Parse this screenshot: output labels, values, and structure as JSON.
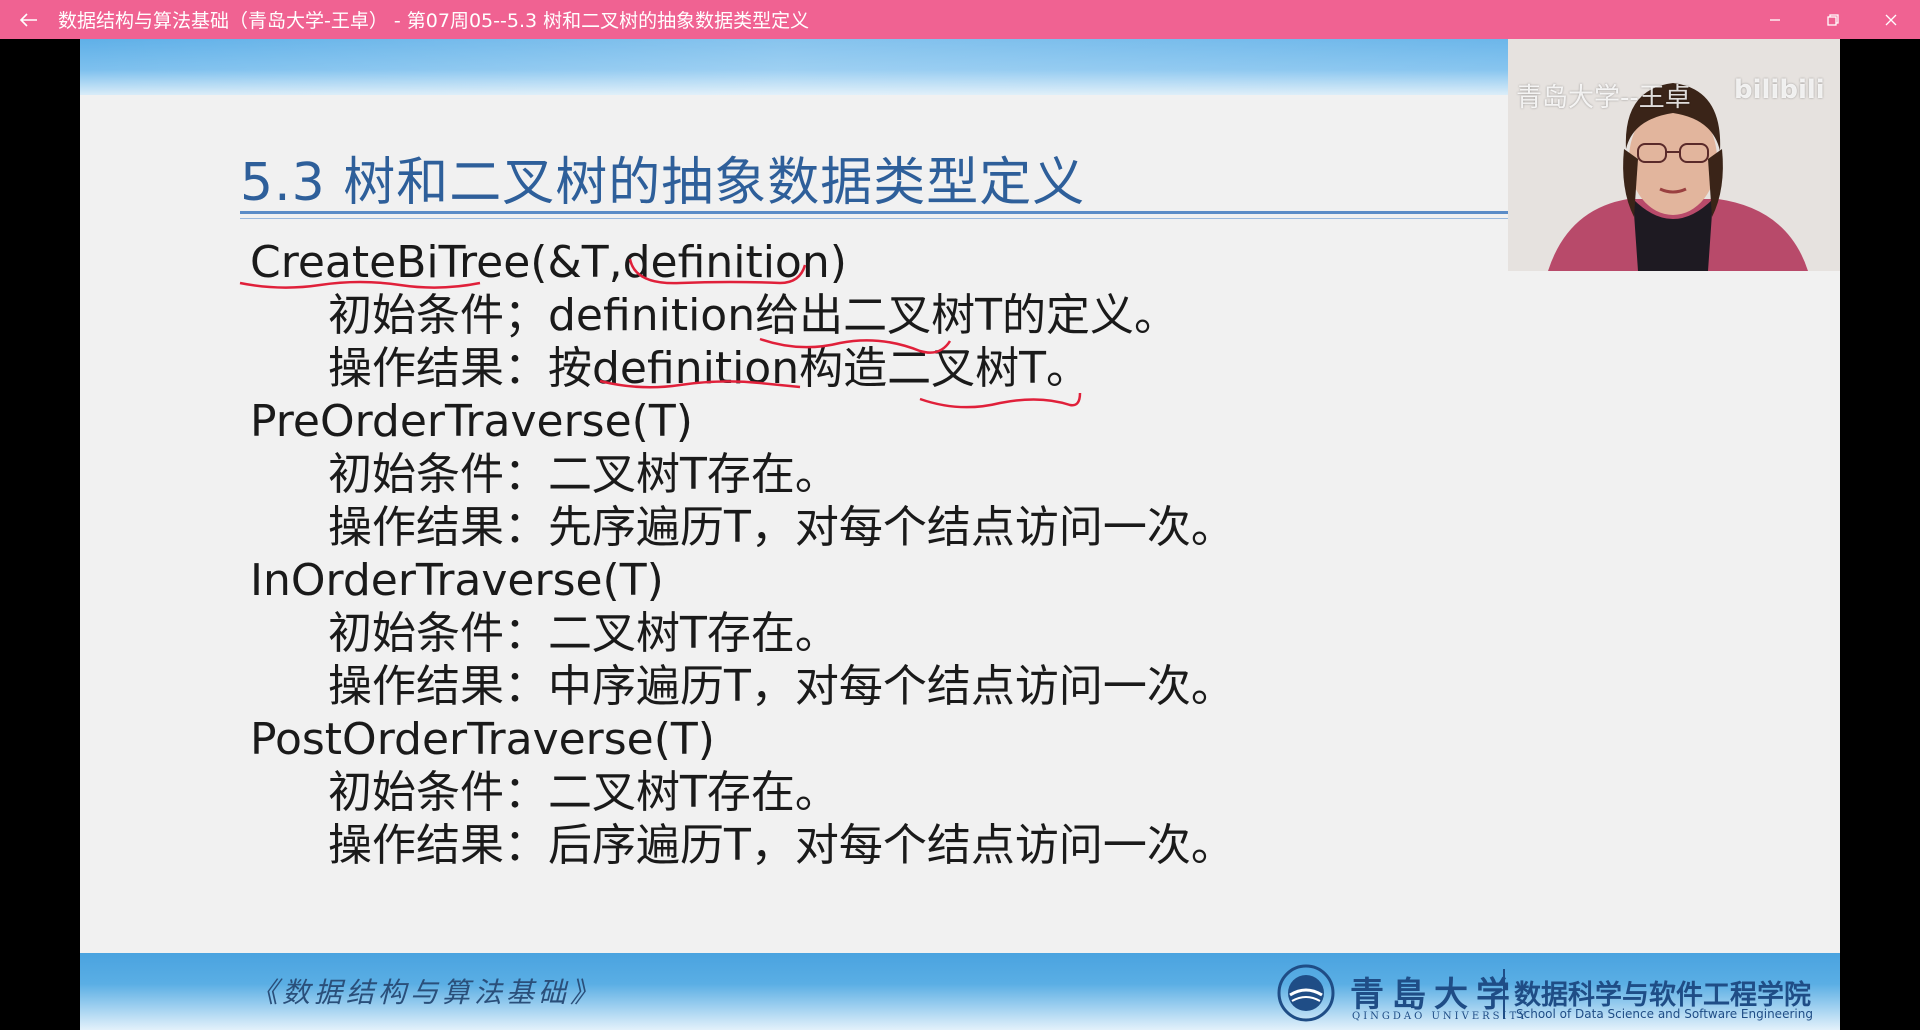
{
  "window": {
    "title": "数据结构与算法基础（青岛大学-王卓） - 第07周05--5.3 树和二叉树的抽象数据类型定义",
    "back_icon": "arrow-left-icon",
    "controls": [
      "minimize-icon",
      "restore-icon",
      "close-icon"
    ]
  },
  "slide": {
    "title": "5.3 树和二叉树的抽象数据类型定义",
    "lines": [
      {
        "kind": "fn",
        "text": "CreateBiTree(&T,definition)"
      },
      {
        "kind": "ln",
        "text": "初始条件；definition给出二叉树T的定义。"
      },
      {
        "kind": "ln",
        "text": "操作结果：按definition构造二叉树T。"
      },
      {
        "kind": "fn",
        "text": "PreOrderTraverse(T)"
      },
      {
        "kind": "ln",
        "text": "初始条件：二叉树T存在。"
      },
      {
        "kind": "ln",
        "text": "操作结果：先序遍历T，对每个结点访问一次。"
      },
      {
        "kind": "fn",
        "text": "InOrderTraverse(T)"
      },
      {
        "kind": "ln",
        "text": "初始条件：二叉树T存在。"
      },
      {
        "kind": "ln",
        "text": "操作结果：中序遍历T，对每个结点访问一次。"
      },
      {
        "kind": "fn",
        "text": "PostOrderTraverse(T)"
      },
      {
        "kind": "ln",
        "text": "初始条件：二叉树T存在。"
      },
      {
        "kind": "ln",
        "text": "操作结果：后序遍历T，对每个结点访问一次。"
      }
    ],
    "annotation_color": "#e0203a"
  },
  "footer": {
    "course": "《数据结构与算法基础》",
    "university": "青島大学",
    "university_en": "QINGDAO UNIVERSITY",
    "school_cn": "数据科学与软件工程学院",
    "school_en": "School of Data Science and Software Engineering"
  },
  "webcam": {
    "watermark": "青岛大学--王卓",
    "logo": "bilibili"
  }
}
